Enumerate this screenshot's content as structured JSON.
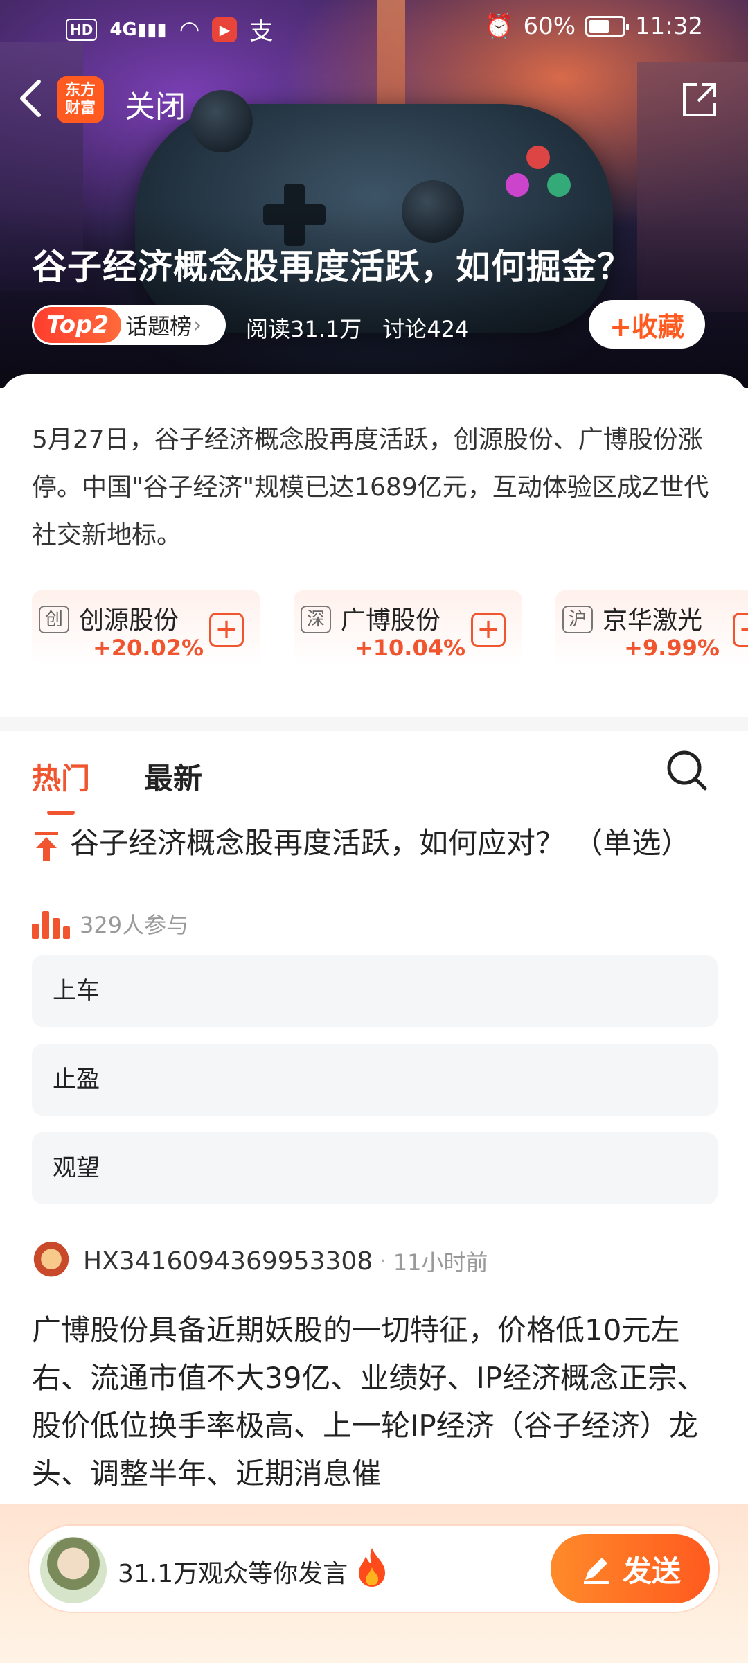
{
  "status_bar": {
    "hd": "HD",
    "network": "4G",
    "app_badge": "▶",
    "pay_icon": "支",
    "battery": "60%",
    "battery_level": 0.6,
    "time": "11:32"
  },
  "nav": {
    "logo_line1": "东方",
    "logo_line2": "财富",
    "close": "关闭"
  },
  "topic": {
    "title": "谷子经济概念股再度活跃，如何掘金？",
    "rank": "Top2",
    "rank_label": "话题榜",
    "reads": "阅读31.1万",
    "discussions": "讨论424",
    "favorite": "+收藏",
    "intro": "5月27日，谷子经济概念股再度活跃，创源股份、广博股份涨停。中国\"谷子经济\"规模已达1689亿元，互动体验区成Z世代社交新地标。"
  },
  "stocks": [
    {
      "exchange": "创",
      "name": "创源股份",
      "change": "+20.02%"
    },
    {
      "exchange": "深",
      "name": "广博股份",
      "change": "+10.04%"
    },
    {
      "exchange": "沪",
      "name": "京华激光",
      "change": "+9.99%"
    }
  ],
  "tabs": {
    "hot": "热门",
    "latest": "最新"
  },
  "poll": {
    "question": "谷子经济概念股再度活跃，如何应对？ （单选）",
    "participants": "329人参与",
    "options": [
      "上车",
      "止盈",
      "观望"
    ]
  },
  "post": {
    "username": "HX3416094369953308",
    "separator": "·",
    "time": "11小时前",
    "body": "广博股份具备近期妖股的一切特征，价格低10元左右、流通市值不大39亿、业绩好、IP经济概念正宗、股价低位换手率极高、上一轮IP经济（谷子经济）龙头、调整半年、近期消息催"
  },
  "comment_bar": {
    "placeholder": "31.1万观众等你发言",
    "send": "发送"
  },
  "colors": {
    "accent": "#f0552f",
    "brand": "#ff5a1f"
  }
}
